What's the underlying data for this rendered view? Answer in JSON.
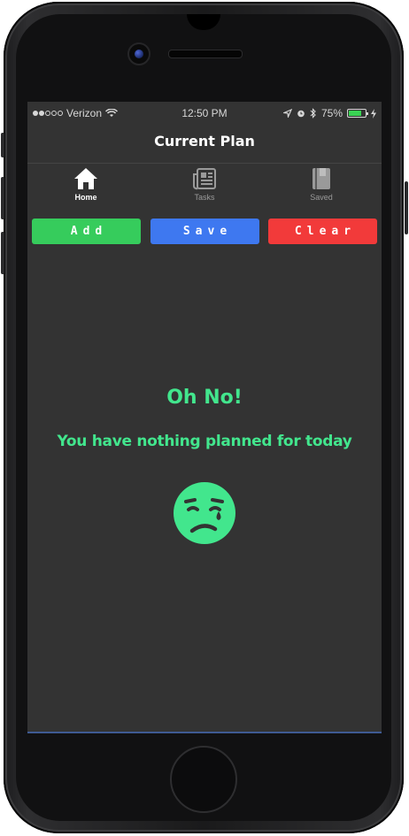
{
  "status_bar": {
    "carrier": "Verizon",
    "time": "12:50 PM",
    "battery_percent": "75%",
    "battery_level": 0.75,
    "battery_color": "#39d353"
  },
  "nav": {
    "title": "Current Plan"
  },
  "tabs": [
    {
      "label": "Home",
      "icon": "home-icon",
      "active": true
    },
    {
      "label": "Tasks",
      "icon": "newspaper-icon",
      "active": false
    },
    {
      "label": "Saved",
      "icon": "book-icon",
      "active": false
    }
  ],
  "actions": {
    "add_label": "Add",
    "save_label": "Save",
    "clear_label": "Clear",
    "add_color": "#36cc5c",
    "save_color": "#3e78f0",
    "clear_color": "#f23a3a"
  },
  "empty_state": {
    "title": "Oh No!",
    "message": "You have nothing planned for today",
    "icon": "sad-face-icon",
    "color": "#42e68d"
  }
}
